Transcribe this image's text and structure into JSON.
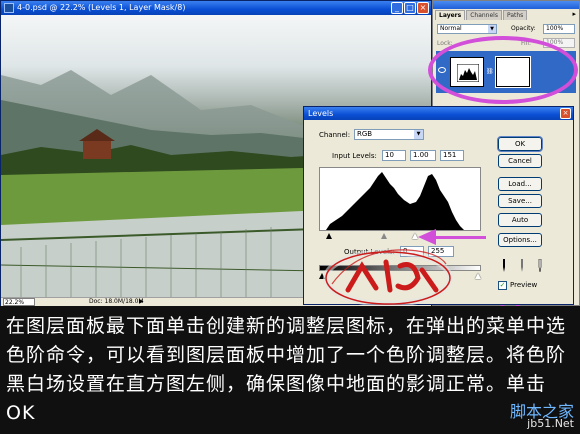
{
  "document": {
    "title": "4-0.psd @ 22.2% (Levels 1, Layer Mask/8)",
    "zoom": "22.2%",
    "doc_size": "Doc: 18.0M/18.0M"
  },
  "layers_panel": {
    "tabs": [
      "Layers",
      "Channels",
      "Paths"
    ],
    "blend_mode": "Normal",
    "opacity_label": "Opacity:",
    "opacity": "100%",
    "lock_label": "Lock:",
    "fill_label": "Fill:",
    "fill": "100%"
  },
  "levels_dialog": {
    "title": "Levels",
    "channel_label": "Channel:",
    "channel": "RGB",
    "input_levels_label": "Input Levels:",
    "input_black": "10",
    "input_gamma": "1.00",
    "input_white": "151",
    "output_levels_label": "Output Levels:",
    "output_black": "0",
    "output_white": "255",
    "buttons": {
      "ok": "OK",
      "cancel": "Cancel",
      "load": "Load...",
      "save": "Save...",
      "auto": "Auto",
      "options": "Options..."
    },
    "preview_label": "Preview",
    "preview_checked": true
  },
  "watermark": {
    "handwriting": "wangqinian@sina.com"
  },
  "caption": {
    "text": "在图层面板最下面单击创建新的调整层图标，在弹出的菜单中选色阶命令，可以看到图层面板中增加了一个色阶调整层。将色阶黑白场设置在直方图左侧，确保图像中地面的影调正常。单击OK",
    "site_mark_line1": "脚本之家",
    "site_mark_line2": "jb51.Net"
  },
  "colors": {
    "annotation": "#d14fd9",
    "titlebar": "#0a4fd4",
    "caption_bg": "#101010"
  }
}
